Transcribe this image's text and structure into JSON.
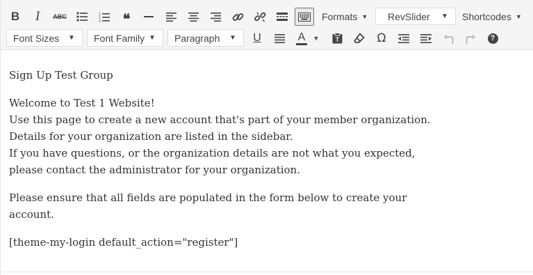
{
  "toolbar": {
    "row1": {
      "formats_label": "Formats",
      "revslider_label": "RevSlider",
      "shortcodes_label": "Shortcodes"
    },
    "row2": {
      "font_sizes_label": "Font Sizes",
      "font_family_label": "Font Family",
      "paragraph_label": "Paragraph"
    },
    "glyphs": {
      "bold": "B",
      "italic": "I",
      "strikethrough": "ABC",
      "blockquote": "❝",
      "omega": "Ω",
      "underline": "U",
      "text_color": "A",
      "help": "?"
    }
  },
  "content": {
    "title_line": "Sign Up Test Group",
    "welcome": "Welcome to Test 1 Website!",
    "line2": "Use this page to create a new account that's part of your member organization.",
    "line3": "Details for your organization are listed in the sidebar.",
    "line4": "If you have questions, or the organization details are not what you expected,",
    "line5": "please contact the administrator for your organization.",
    "para3_line1": "Please ensure that all fields are populated in the form below to create your",
    "para3_line2": "account.",
    "shortcode": "[theme-my-login default_action=\"register\"]"
  }
}
